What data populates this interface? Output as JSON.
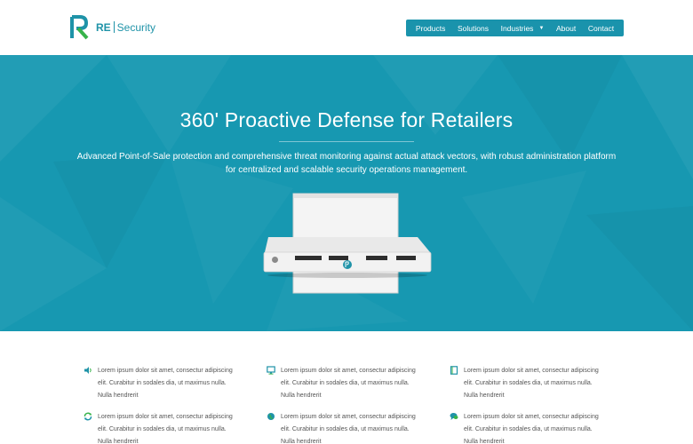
{
  "brand": {
    "logo_re": "RE",
    "logo_security": "Security",
    "accent": "#1a93ac"
  },
  "nav": {
    "items": [
      {
        "label": "Products"
      },
      {
        "label": "Solutions"
      },
      {
        "label": "Industries",
        "has_dropdown": true
      },
      {
        "label": "About"
      },
      {
        "label": "Contact"
      }
    ]
  },
  "hero": {
    "title": "360' Proactive Defense for Retailers",
    "subtitle": "Advanced Point-of-Sale protection and comprehensive threat monitoring against actual attack vectors, with robust administration platform for centralized and scalable security operations management.",
    "background": "#1798b1"
  },
  "features": {
    "items": [
      {
        "icon": "speaker-icon",
        "text": "Lorem ipsum dolor sit amet, consectur adipiscing elit. Curabitur in sodales dia, ut maximus nulla. Nulla hendrerit"
      },
      {
        "icon": "monitor-icon",
        "text": "Lorem ipsum dolor sit amet, consectur adipiscing elit. Curabitur in sodales dia, ut maximus nulla. Nulla hendrerit"
      },
      {
        "icon": "book-icon",
        "text": "Lorem ipsum dolor sit amet, consectur adipiscing elit. Curabitur in sodales dia, ut maximus nulla. Nulla hendrerit"
      },
      {
        "icon": "refresh-icon",
        "text": "Lorem ipsum dolor sit amet, consectur adipiscing elit. Curabitur in sodales dia, ut maximus nulla. Nulla hendrerit"
      },
      {
        "icon": "globe-icon",
        "text": "Lorem ipsum dolor sit amet, consectur adipiscing elit. Curabitur in sodales dia, ut maximus nulla. Nulla hendrerit"
      },
      {
        "icon": "chat-icon",
        "text": "Lorem ipsum dolor sit amet, consectur adipiscing elit. Curabitur in sodales dia, ut maximus nulla. Nulla hendrerit"
      }
    ]
  }
}
